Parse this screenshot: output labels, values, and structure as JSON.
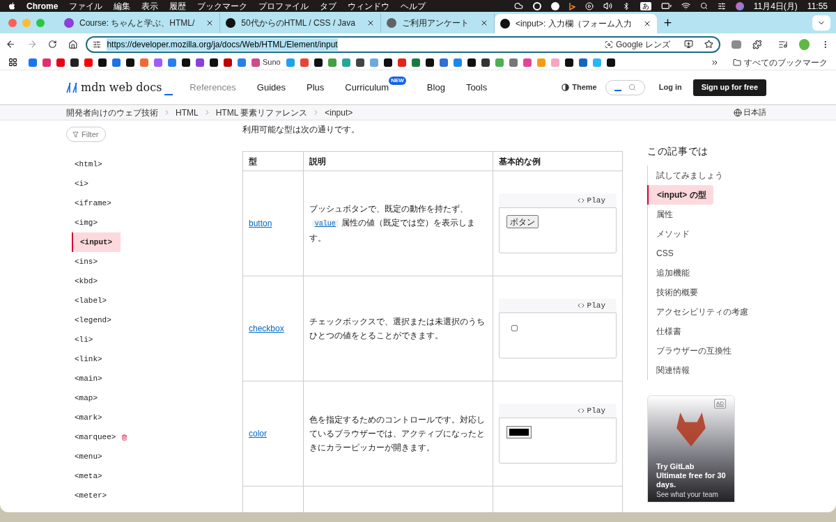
{
  "menubar": {
    "app": "Chrome",
    "menus": [
      "ファイル",
      "編集",
      "表示",
      "履歴",
      "ブックマーク",
      "プロファイル",
      "タブ",
      "ウィンドウ",
      "ヘルプ"
    ],
    "ime": "あ",
    "date": "11月4日(月)",
    "time": "11:55"
  },
  "tabs": [
    {
      "title": "Course: ちゃんと学ぶ、HTML/",
      "selected": false,
      "color": "#8b3fd9"
    },
    {
      "title": "50代からのHTML / CSS / Java",
      "selected": false,
      "color": "#111111"
    },
    {
      "title": "ご利用アンケート",
      "selected": false,
      "color": "#5f6368"
    },
    {
      "title": "<input>: 入力欄（フォーム入力",
      "selected": true,
      "color": "#111111"
    }
  ],
  "address": {
    "url": "https://developer.mozilla.org/ja/docs/Web/HTML/Element/input",
    "lens": "Google レンズ"
  },
  "bookmarks": [
    {
      "color": "#1877f2"
    },
    {
      "color": "#e1306c"
    },
    {
      "color": "#e60012"
    },
    {
      "color": "#222222"
    },
    {
      "color": "#ff0000"
    },
    {
      "color": "#111111"
    },
    {
      "color": "#1a73e8"
    },
    {
      "color": "#111111"
    },
    {
      "color": "#f06a35"
    },
    {
      "color": "#a259ff"
    },
    {
      "color": "#2680eb"
    },
    {
      "color": "#111111"
    },
    {
      "color": "#8b3fd9"
    },
    {
      "color": "#111111"
    },
    {
      "color": "#bf0000"
    },
    {
      "color": "#2b7de9"
    },
    {
      "color": "#d04a8a",
      "label": "Suno"
    },
    {
      "color": "#1da1f2"
    },
    {
      "color": "#ea4335"
    },
    {
      "color": "#111111"
    },
    {
      "color": "#43a047"
    },
    {
      "color": "#26a69a"
    },
    {
      "color": "#444444"
    },
    {
      "color": "#6fa8dc"
    },
    {
      "color": "#111111"
    },
    {
      "color": "#e1251b"
    },
    {
      "color": "#1b7a43"
    },
    {
      "color": "#111111"
    },
    {
      "color": "#2f6fd6"
    },
    {
      "color": "#1e88e5"
    },
    {
      "color": "#111111"
    },
    {
      "color": "#333333"
    },
    {
      "color": "#4caf50"
    },
    {
      "color": "#777777"
    },
    {
      "color": "#e84393"
    },
    {
      "color": "#f39c12"
    },
    {
      "color": "#f8a5c2"
    },
    {
      "color": "#111111"
    },
    {
      "color": "#1565c0"
    },
    {
      "color": "#29b6f6"
    },
    {
      "color": "#111111"
    }
  ],
  "all_bookmarks": "すべてのブックマーク",
  "mdn": {
    "logo": "mdn web docs",
    "nav": [
      {
        "label": "References",
        "selected": true
      },
      {
        "label": "Guides",
        "selected": false
      },
      {
        "label": "Plus",
        "selected": false
      },
      {
        "label": "Curriculum",
        "selected": false,
        "badge": "NEW"
      },
      {
        "label": "Blog",
        "selected": false
      },
      {
        "label": "Tools",
        "selected": false
      }
    ],
    "theme": "Theme",
    "login": "Log in",
    "signup": "Sign up for free"
  },
  "breadcrumbs": [
    "開発者向けのウェブ技術",
    "HTML",
    "HTML 要素リファレンス",
    "<input>"
  ],
  "language": "日本語",
  "sidebar": {
    "filter_placeholder": "Filter",
    "items": [
      {
        "label": "<html>",
        "selected": false,
        "deprecated": false
      },
      {
        "label": "<i>",
        "selected": false,
        "deprecated": false
      },
      {
        "label": "<iframe>",
        "selected": false,
        "deprecated": false
      },
      {
        "label": "<img>",
        "selected": false,
        "deprecated": false
      },
      {
        "label": "<input>",
        "selected": true,
        "deprecated": false
      },
      {
        "label": "<ins>",
        "selected": false,
        "deprecated": false
      },
      {
        "label": "<kbd>",
        "selected": false,
        "deprecated": false
      },
      {
        "label": "<label>",
        "selected": false,
        "deprecated": false
      },
      {
        "label": "<legend>",
        "selected": false,
        "deprecated": false
      },
      {
        "label": "<li>",
        "selected": false,
        "deprecated": false
      },
      {
        "label": "<link>",
        "selected": false,
        "deprecated": false
      },
      {
        "label": "<main>",
        "selected": false,
        "deprecated": false
      },
      {
        "label": "<map>",
        "selected": false,
        "deprecated": false
      },
      {
        "label": "<mark>",
        "selected": false,
        "deprecated": false
      },
      {
        "label": "<marquee>",
        "selected": false,
        "deprecated": true
      },
      {
        "label": "<menu>",
        "selected": false,
        "deprecated": false
      },
      {
        "label": "<meta>",
        "selected": false,
        "deprecated": false
      },
      {
        "label": "<meter>",
        "selected": false,
        "deprecated": false
      }
    ]
  },
  "intro": "利用可能な型は次の通りです。",
  "table": {
    "columns": [
      "型",
      "説明",
      "基本的な例"
    ],
    "rows": [
      {
        "type": "button",
        "description": "プッシュボタンで、既定の動作を持たず、",
        "code": "value",
        "description_after": "属性の値（既定では空）を表示します。",
        "example": {
          "kind": "button",
          "play": "Play",
          "label": "ボタン"
        }
      },
      {
        "type": "checkbox",
        "description": "チェックボックスで、選択または未選択のうちひとつの値をとることができます。",
        "example": {
          "kind": "checkbox",
          "play": "Play",
          "checked": false
        }
      },
      {
        "type": "color",
        "description": "色を指定するためのコントロールです。対応しているブラウザーでは、アクティブになったときにカラーピッカーが開きます。",
        "example": {
          "kind": "color",
          "play": "Play",
          "color": "#000000"
        }
      }
    ]
  },
  "toc": {
    "title": "この記事では",
    "items": [
      {
        "label": "試してみましょう",
        "selected": false
      },
      {
        "label": "<input> の型",
        "selected": true
      },
      {
        "label": "属性",
        "selected": false
      },
      {
        "label": "メソッド",
        "selected": false
      },
      {
        "label": "CSS",
        "selected": false
      },
      {
        "label": "追加機能",
        "selected": false
      },
      {
        "label": "技術的概要",
        "selected": false
      },
      {
        "label": "アクセシビリティの考慮",
        "selected": false
      },
      {
        "label": "仕様書",
        "selected": false
      },
      {
        "label": "ブラウザーの互換性",
        "selected": false
      },
      {
        "label": "関連情報",
        "selected": false
      }
    ]
  },
  "ad": {
    "badge": "AD",
    "title": "Try GitLab Ultimate free for 30 days.",
    "subtitle": "See what your team"
  }
}
